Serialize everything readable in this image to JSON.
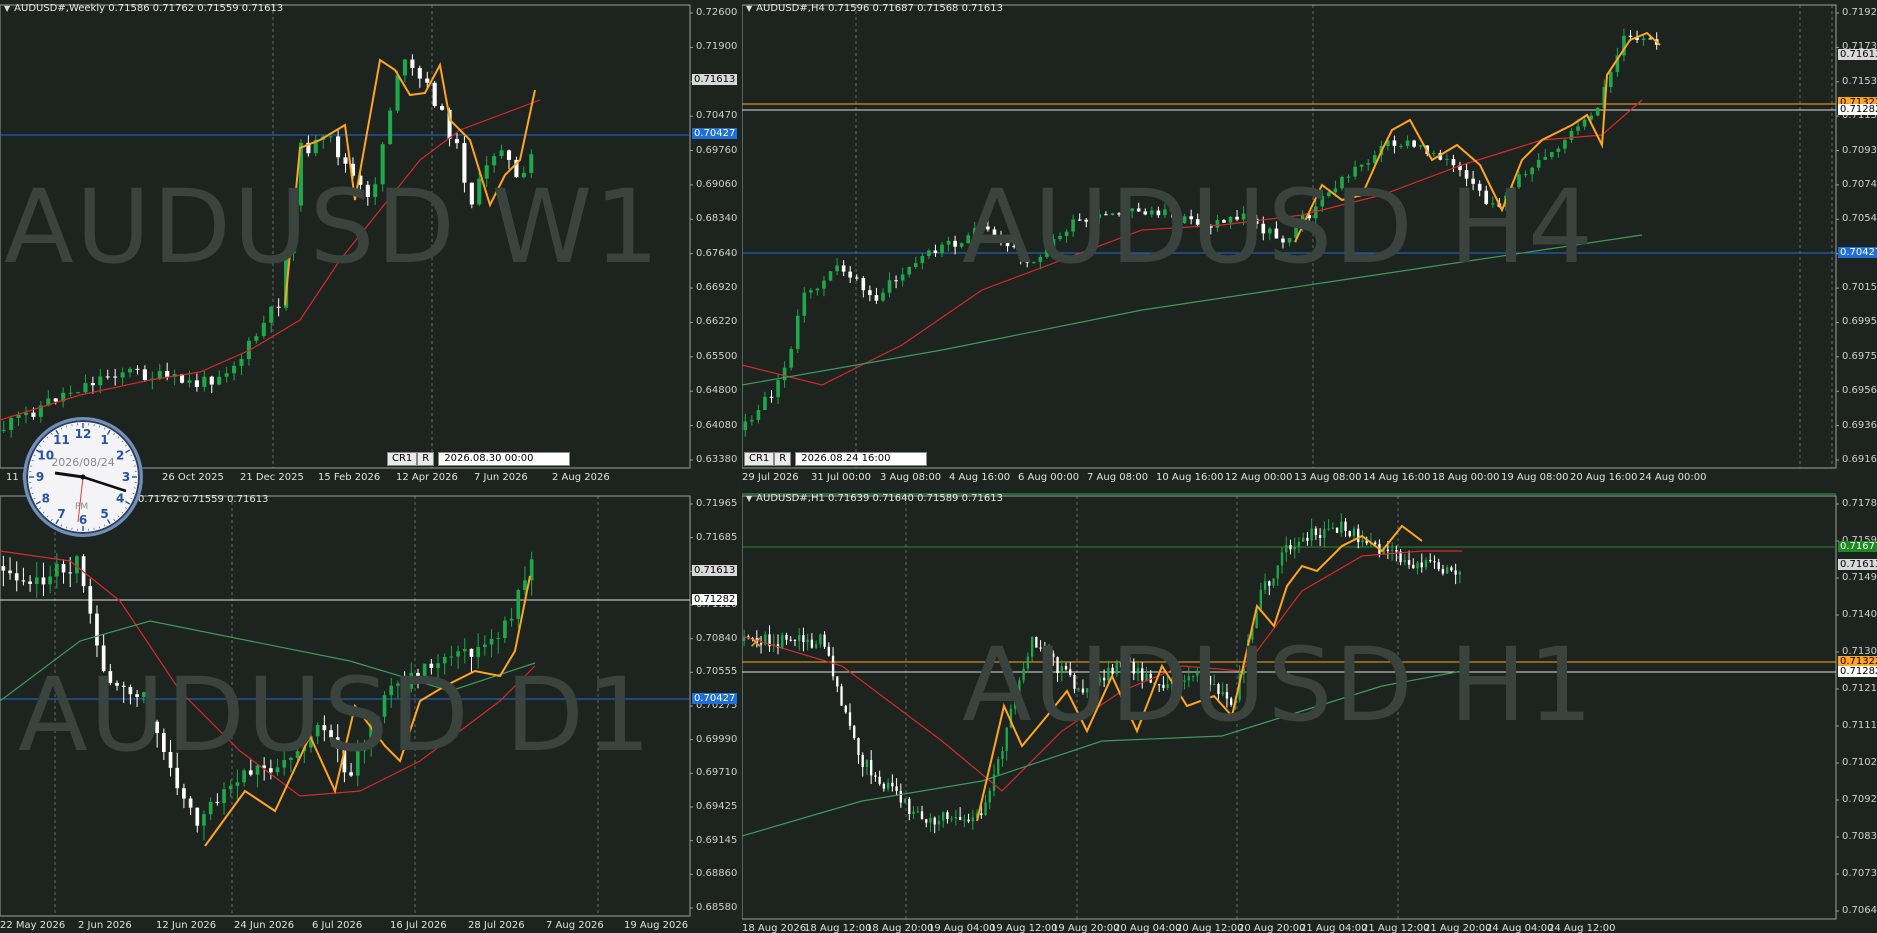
{
  "colors": {
    "bg": "#1d231f",
    "candle_up": "#1fa84a",
    "candle_down": "#ffffff",
    "zigzag": "#ffa51f",
    "ma_fast": "#d42b2b",
    "ma_slow": "#3f9a5f",
    "level_blue": "#1f6fd9",
    "level_orange": "#ffa51f",
    "level_white": "#ffffff",
    "level_green": "#2e8a2e"
  },
  "panes": {
    "w1": {
      "header": "AUDUSD#,Weekly  0.71586 0.71762 0.71559 0.71613",
      "watermark": "AUDUSD W1",
      "price_labels": [
        "0.72600",
        "0.71900",
        "0.71180",
        "0.70470",
        "0.69760",
        "0.69060",
        "0.68340",
        "0.67640",
        "0.66920",
        "0.66220",
        "0.65500",
        "0.64800",
        "0.64080",
        "0.63380"
      ],
      "time_labels": [
        "11 M",
        "Aug 2025",
        "26 Oct 2025",
        "21 Dec 2025",
        "15 Feb 2026",
        "12 Apr 2026",
        "7 Jun 2026",
        "2 Aug 2026"
      ],
      "tags": [
        {
          "text": "0.71613",
          "color": "light"
        },
        {
          "text": "0.70427",
          "color": "blue"
        }
      ],
      "nav": {
        "btn1": "CR1",
        "btn2": "R",
        "datetime": "2026.08.30 00:00"
      }
    },
    "h4": {
      "header": "AUDUSD#,H4  0.71596 0.71687 0.71568 0.71613",
      "watermark": "AUDUSD H4",
      "price_labels": [
        "0.71925",
        "0.71730",
        "0.71530",
        "0.71135",
        "0.70935",
        "0.70745",
        "0.70545",
        "0.70350",
        "0.70150",
        "0.69955",
        "0.69755",
        "0.69560",
        "0.69360",
        "0.69165"
      ],
      "time_labels": [
        "29 Jul 2026",
        "31 Jul 00:00",
        "3 Aug 08:00",
        "4 Aug 16:00",
        "6 Aug 00:00",
        "7 Aug 08:00",
        "10 Aug 16:00",
        "12 Aug 00:00",
        "13 Aug 08:00",
        "14 Aug 16:00",
        "18 Aug 00:00",
        "19 Aug 08:00",
        "20 Aug 16:00",
        "24 Aug 00:00"
      ],
      "tags": [
        {
          "text": "0.71613",
          "color": "light"
        },
        {
          "text": "0.71322",
          "color": "orange"
        },
        {
          "text": "0.71282",
          "color": "white"
        },
        {
          "text": "0.70427",
          "color": "blue"
        }
      ],
      "nav": {
        "btn1": "CR1",
        "btn2": "R",
        "datetime": "2026.08.24 16:00"
      }
    },
    "d1": {
      "header": "AUDUSD#,Daily  0.71586 0.71762 0.71559 0.71613",
      "header_visible": "0.71762 0.71559 0.71613",
      "watermark": "AUDUSD D1",
      "price_labels": [
        "0.71965",
        "0.71685",
        "0.71405",
        "0.71120",
        "0.70840",
        "0.70555",
        "0.70275",
        "0.69990",
        "0.69710",
        "0.69425",
        "0.69145",
        "0.68860",
        "0.68580"
      ],
      "time_labels": [
        "22 May 2026",
        "2 Jun 2026",
        "12 Jun 2026",
        "24 Jun 2026",
        "6 Jul 2026",
        "16 Jul 2026",
        "28 Jul 2026",
        "7 Aug 2026",
        "19 Aug 2026"
      ],
      "tags": [
        {
          "text": "0.71613",
          "color": "light"
        },
        {
          "text": "0.71282",
          "color": "white"
        },
        {
          "text": "0.70427",
          "color": "blue"
        }
      ]
    },
    "h1": {
      "header": "AUDUSD#,H1  0.71639 0.71640 0.71589 0.71613",
      "watermark": "AUDUSD H1",
      "price_labels": [
        "0.71780",
        "0.71590",
        "0.71495",
        "0.71400",
        "0.71305",
        "0.71210",
        "0.71115",
        "0.71020",
        "0.70925",
        "0.70830",
        "0.70735",
        "0.70640"
      ],
      "time_labels": [
        "18 Aug 2026",
        "18 Aug 12:00",
        "18 Aug 20:00",
        "19 Aug 04:00",
        "19 Aug 12:00",
        "19 Aug 20:00",
        "20 Aug 04:00",
        "20 Aug 12:00",
        "20 Aug 20:00",
        "21 Aug 04:00",
        "21 Aug 12:00",
        "21 Aug 20:00",
        "24 Aug 04:00",
        "24 Aug 12:00"
      ],
      "tags": [
        {
          "text": "0.71677",
          "color": "green"
        },
        {
          "text": "0.71613",
          "color": "light"
        },
        {
          "text": "0.71322",
          "color": "orange"
        },
        {
          "text": "0.71282",
          "color": "white"
        }
      ]
    }
  },
  "clock": {
    "date": "2026/08/24",
    "ampm": "PM",
    "numbers": [
      "12",
      "1",
      "2",
      "3",
      "4",
      "5",
      "6",
      "7",
      "8",
      "9",
      "10",
      "11"
    ]
  },
  "icons": {
    "clock": "analog-clock-widget",
    "tool": "crosshair-tool-icon"
  }
}
